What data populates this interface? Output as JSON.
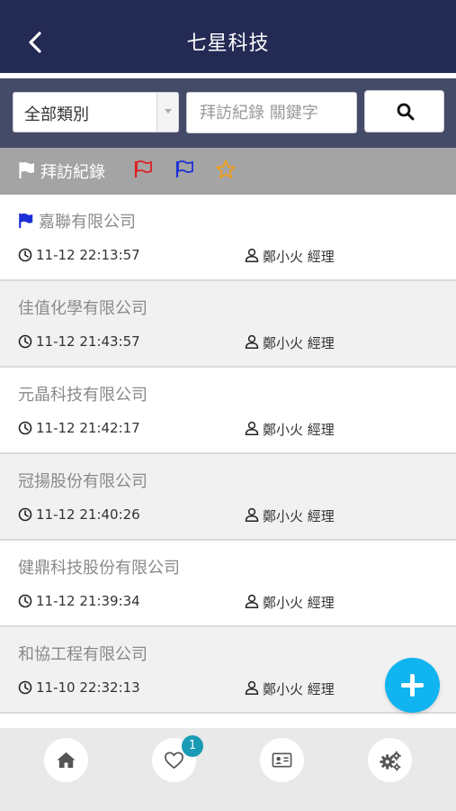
{
  "header": {
    "title": "七星科技",
    "back_icon": "chevron-left-icon"
  },
  "search": {
    "category_value": "全部類別",
    "keyword_placeholder": "拜訪紀錄 關鍵字",
    "keyword_value": "",
    "search_icon": "search-icon"
  },
  "filter": {
    "label": "拜訪紀錄",
    "flags": [
      {
        "icon": "flag-outline-icon",
        "color": "#e02020"
      },
      {
        "icon": "flag-outline-icon",
        "color": "#1c2fd6"
      },
      {
        "icon": "star-outline-icon",
        "color": "#f0a020"
      }
    ]
  },
  "records": [
    {
      "company": "嘉聯有限公司",
      "time": "11-12 22:13:57",
      "contact": "鄭小火 經理",
      "flag": "blue"
    },
    {
      "company": "佳值化學有限公司",
      "time": "11-12 21:43:57",
      "contact": "鄭小火 經理"
    },
    {
      "company": "元晶科技有限公司",
      "time": "11-12 21:42:17",
      "contact": "鄭小火 經理"
    },
    {
      "company": "冠揚股份有限公司",
      "time": "11-12 21:40:26",
      "contact": "鄭小火 經理"
    },
    {
      "company": "健鼎科技股份有限公司",
      "time": "11-12 21:39:34",
      "contact": "鄭小火 經理"
    },
    {
      "company": "和協工程有限公司",
      "time": "11-10 22:32:13",
      "contact": "鄭小火 經理"
    }
  ],
  "colors": {
    "header": "#232a54",
    "searchbar": "#444b69",
    "filterbar": "#a4a4a4",
    "accent": "#0fb4f0",
    "badge": "#1a9bb5"
  },
  "tabbar": {
    "tabs": [
      {
        "icon": "home-icon"
      },
      {
        "icon": "heart-icon",
        "badge": "1"
      },
      {
        "icon": "contact-card-icon"
      },
      {
        "icon": "gears-icon"
      }
    ]
  },
  "fab_icon": "plus-icon"
}
